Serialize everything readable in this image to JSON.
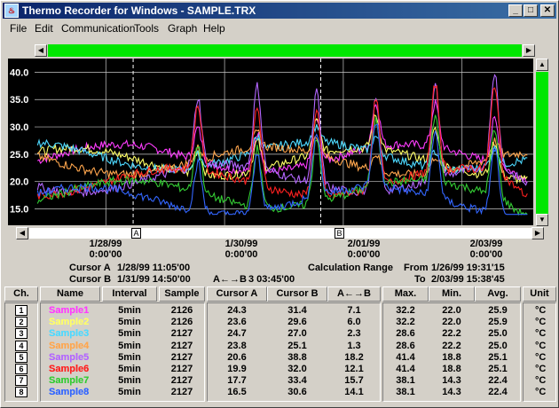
{
  "window": {
    "title": "Thermo Recorder for Windows - SAMPLE.TRX",
    "minimize": "_",
    "maximize": "□",
    "close": "✕"
  },
  "menu": [
    "File",
    "Edit",
    "Communication",
    "Tools",
    "Graph",
    "Help"
  ],
  "colors": {
    "graph_bg": "#000000",
    "scrollbar_green": "#00e600"
  },
  "chart_data": {
    "type": "line",
    "yticks": [
      "40.0",
      "35.0",
      "30.0",
      "25.0",
      "20.0",
      "15.0"
    ],
    "ylim": [
      12,
      42.5
    ],
    "xticks": [
      {
        "date": "1/28/99",
        "time": "0:00'00"
      },
      {
        "date": "1/30/99",
        "time": "0:00'00"
      },
      {
        "date": "2/01/99",
        "time": "0:00'00"
      },
      {
        "date": "2/03/99",
        "time": "0:00'00"
      }
    ],
    "x_day_range": [
      26.8,
      35.2
    ],
    "cursor_a_marker": "A",
    "cursor_b_marker": "B",
    "series": [
      {
        "name": "Sample1",
        "color": "#ff3cff",
        "base": 24.3,
        "amp": 8
      },
      {
        "name": "Sample2",
        "color": "#ffff66",
        "base": 23.6,
        "amp": 6
      },
      {
        "name": "Sample3",
        "color": "#4dd9ff",
        "base": 24.7,
        "amp": 3
      },
      {
        "name": "Sample4",
        "color": "#ffa64d",
        "base": 23.8,
        "amp": 3
      },
      {
        "name": "Sample5",
        "color": "#b366ff",
        "base": 20.6,
        "amp": 17
      },
      {
        "name": "Sample6",
        "color": "#ff2020",
        "base": 19.9,
        "amp": 16
      },
      {
        "name": "Sample7",
        "color": "#33cc33",
        "base": 17.7,
        "amp": 12
      },
      {
        "name": "Sample8",
        "color": "#3366ff",
        "base": 16.5,
        "amp": 12
      }
    ]
  },
  "cursors": {
    "a_label": "Cursor A",
    "a_value": "1/28/99 11:05'00",
    "b_label": "Cursor B",
    "b_value": "1/31/99 14:50'00",
    "ab_label": "A←→B",
    "ab_value": "3 03:45'00"
  },
  "calc_range": {
    "label": "Calculation Range",
    "from_label": "From",
    "from_value": "1/26/99 19:31'15",
    "to_label": "To",
    "to_value": "2/03/99 15:38'45"
  },
  "table": {
    "headers": [
      "Ch.",
      "Name",
      "Interval",
      "Sample",
      "Cursor A",
      "Cursor B",
      "A←→B",
      "Max.",
      "Min.",
      "Avg.",
      "Unit"
    ],
    "rows": [
      {
        "ch": "1",
        "name": "Sample1",
        "interval": "5min",
        "sample": "2126",
        "ca": "24.3",
        "cb": "31.4",
        "ab": "7.1",
        "max": "32.2",
        "min": "22.0",
        "avg": "25.9",
        "unit": "°C"
      },
      {
        "ch": "2",
        "name": "Sample2",
        "interval": "5min",
        "sample": "2126",
        "ca": "23.6",
        "cb": "29.6",
        "ab": "6.0",
        "max": "32.2",
        "min": "22.0",
        "avg": "25.9",
        "unit": "°C"
      },
      {
        "ch": "3",
        "name": "Sample3",
        "interval": "5min",
        "sample": "2127",
        "ca": "24.7",
        "cb": "27.0",
        "ab": "2.3",
        "max": "28.6",
        "min": "22.2",
        "avg": "25.0",
        "unit": "°C"
      },
      {
        "ch": "4",
        "name": "Sample4",
        "interval": "5min",
        "sample": "2127",
        "ca": "23.8",
        "cb": "25.1",
        "ab": "1.3",
        "max": "28.6",
        "min": "22.2",
        "avg": "25.0",
        "unit": "°C"
      },
      {
        "ch": "5",
        "name": "Sample5",
        "interval": "5min",
        "sample": "2127",
        "ca": "20.6",
        "cb": "38.8",
        "ab": "18.2",
        "max": "41.4",
        "min": "18.8",
        "avg": "25.1",
        "unit": "°C"
      },
      {
        "ch": "6",
        "name": "Sample6",
        "interval": "5min",
        "sample": "2127",
        "ca": "19.9",
        "cb": "32.0",
        "ab": "12.1",
        "max": "41.4",
        "min": "18.8",
        "avg": "25.1",
        "unit": "°C"
      },
      {
        "ch": "7",
        "name": "Sample7",
        "interval": "5min",
        "sample": "2127",
        "ca": "17.7",
        "cb": "33.4",
        "ab": "15.7",
        "max": "38.1",
        "min": "14.3",
        "avg": "22.4",
        "unit": "°C"
      },
      {
        "ch": "8",
        "name": "Sample8",
        "interval": "5min",
        "sample": "2127",
        "ca": "16.5",
        "cb": "30.6",
        "ab": "14.1",
        "max": "38.1",
        "min": "14.3",
        "avg": "22.4",
        "unit": "°C"
      }
    ]
  }
}
